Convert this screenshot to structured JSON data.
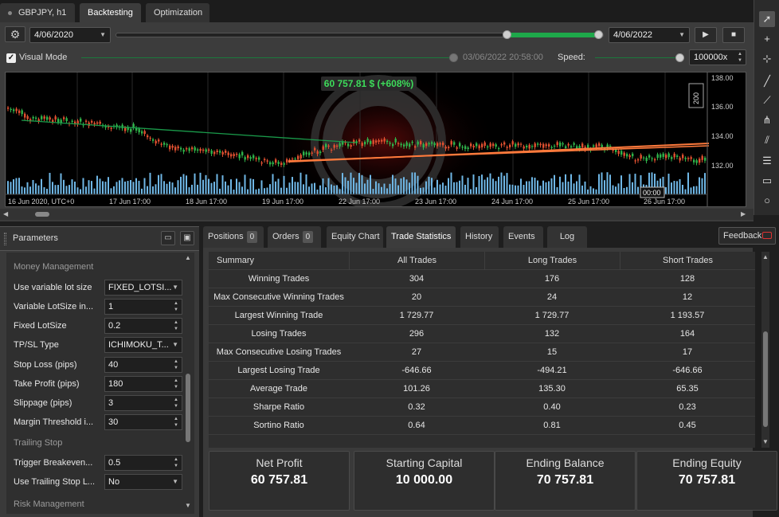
{
  "top_tabs": [
    {
      "label": "GBPJPY, h1"
    },
    {
      "label": "Backtesting"
    },
    {
      "label": "Optimization"
    }
  ],
  "backtest": {
    "start_date": "4/06/2020",
    "end_date": "4/06/2022",
    "visual_mode_label": "Visual Mode",
    "visual_mode_checked": true,
    "current_time": "03/06/2022 20:58:00",
    "speed_label": "Speed:",
    "speed_value": "100000x"
  },
  "chart": {
    "profit_label": "60 757.81 $ (+608%)",
    "price_ticks": [
      "138.00",
      "136.00",
      "134.00",
      "132.00"
    ],
    "scale_label": "200",
    "time_ticks": [
      "16 Jun 2020, UTC+0",
      "17 Jun 17:00",
      "18 Jun 17:00",
      "19 Jun 17:00",
      "22 Jun 17:00",
      "23 Jun 17:00",
      "24 Jun 17:00",
      "25 Jun 17:00",
      "26 Jun 17:00"
    ],
    "time_marker": "00:00"
  },
  "params": {
    "title": "Parameters",
    "sections": {
      "money": "Money Management",
      "trailing": "Trailing Stop",
      "risk": "Risk Management"
    },
    "rows": [
      {
        "label": "Use variable lot size",
        "value": "FIXED_LOTSI..."
      },
      {
        "label": "Variable LotSize in...",
        "value": "1"
      },
      {
        "label": "Fixed LotSize",
        "value": "0.2"
      },
      {
        "label": "TP/SL Type",
        "value": "ICHIMOKU_T..."
      },
      {
        "label": "Stop Loss (pips)",
        "value": "40"
      },
      {
        "label": "Take Profit (pips)",
        "value": "180"
      },
      {
        "label": "Slippage (pips)",
        "value": "3"
      },
      {
        "label": "Margin Threshold i...",
        "value": "30"
      },
      {
        "label": "Trigger Breakeven...",
        "value": "0.5"
      },
      {
        "label": "Use Trailing Stop L...",
        "value": "No"
      }
    ]
  },
  "bottom_tabs": {
    "positions": "Positions",
    "positions_count": "0",
    "orders": "Orders",
    "orders_count": "0",
    "equity": "Equity Chart",
    "stats": "Trade Statistics",
    "history": "History",
    "events": "Events",
    "log": "Log",
    "feedback": "Feedback"
  },
  "stats": {
    "headers": [
      "Summary",
      "All Trades",
      "Long Trades",
      "Short Trades"
    ],
    "rows": [
      [
        "Winning Trades",
        "304",
        "176",
        "128"
      ],
      [
        "Max Consecutive Winning Trades",
        "20",
        "24",
        "12"
      ],
      [
        "Largest Winning Trade",
        "1 729.77",
        "1 729.77",
        "1 193.57"
      ],
      [
        "Losing Trades",
        "296",
        "132",
        "164"
      ],
      [
        "Max Consecutive Losing Trades",
        "27",
        "15",
        "17"
      ],
      [
        "Largest Losing Trade",
        "-646.66",
        "-494.21",
        "-646.66"
      ],
      [
        "Average Trade",
        "101.26",
        "135.30",
        "65.35"
      ],
      [
        "Sharpe Ratio",
        "0.32",
        "0.40",
        "0.23"
      ],
      [
        "Sortino Ratio",
        "0.64",
        "0.81",
        "0.45"
      ]
    ],
    "cards": [
      {
        "title": "Net Profit",
        "value": "60 757.81"
      },
      {
        "title": "Starting Capital",
        "value": "10 000.00"
      },
      {
        "title": "Ending Balance",
        "value": "70 757.81"
      },
      {
        "title": "Ending Equity",
        "value": "70 757.81"
      }
    ]
  },
  "colors": {
    "accent_green": "#1ea84a",
    "profit_green": "#3ddc5a",
    "trendline_orange": "#ff7a3c",
    "bull_candle": "#2fb34a",
    "bear_candle": "#e05030",
    "volume_blue": "#6fb7e6"
  }
}
